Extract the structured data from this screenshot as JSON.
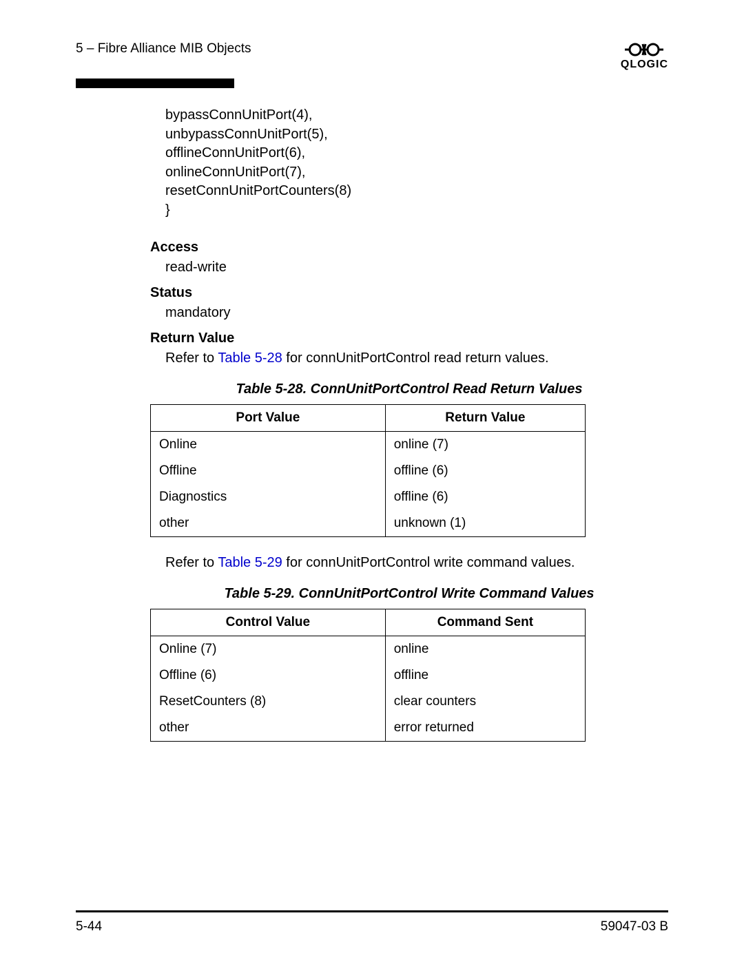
{
  "header": {
    "section": "5 – Fibre Alliance MIB Objects",
    "brand": "QLOGIC"
  },
  "enum_lines": [
    "bypassConnUnitPort(4),",
    "unbypassConnUnitPort(5),",
    "offlineConnUnitPort(6),",
    "onlineConnUnitPort(7),",
    "resetConnUnitPortCounters(8)",
    "}"
  ],
  "sections": {
    "access_label": "Access",
    "access_value": "read-write",
    "status_label": "Status",
    "status_value": "mandatory",
    "return_label": "Return Value",
    "return_ref_prefix": "Refer to ",
    "return_ref_link": "Table 5-28",
    "return_ref_suffix": " for connUnitPortControl read return values.",
    "write_ref_prefix": "Refer to ",
    "write_ref_link": "Table 5-29",
    "write_ref_suffix": " for connUnitPortControl write command values."
  },
  "table28": {
    "caption": "Table 5-28. ConnUnitPortControl Read Return Values",
    "col1": "Port Value",
    "col2": "Return Value",
    "rows": [
      {
        "c1": "Online",
        "c2": "online (7)"
      },
      {
        "c1": "Offline",
        "c2": "offline (6)"
      },
      {
        "c1": "Diagnostics",
        "c2": "offline (6)"
      },
      {
        "c1": "other",
        "c2": "unknown (1)"
      }
    ]
  },
  "table29": {
    "caption": "Table 5-29. ConnUnitPortControl Write Command Values",
    "col1": "Control Value",
    "col2": "Command Sent",
    "rows": [
      {
        "c1": "Online (7)",
        "c2": "online"
      },
      {
        "c1": "Offline (6)",
        "c2": "offline"
      },
      {
        "c1": "ResetCounters (8)",
        "c2": "clear counters"
      },
      {
        "c1": "other",
        "c2": "error returned"
      }
    ]
  },
  "footer": {
    "page": "5-44",
    "doc": "59047-03  B"
  }
}
